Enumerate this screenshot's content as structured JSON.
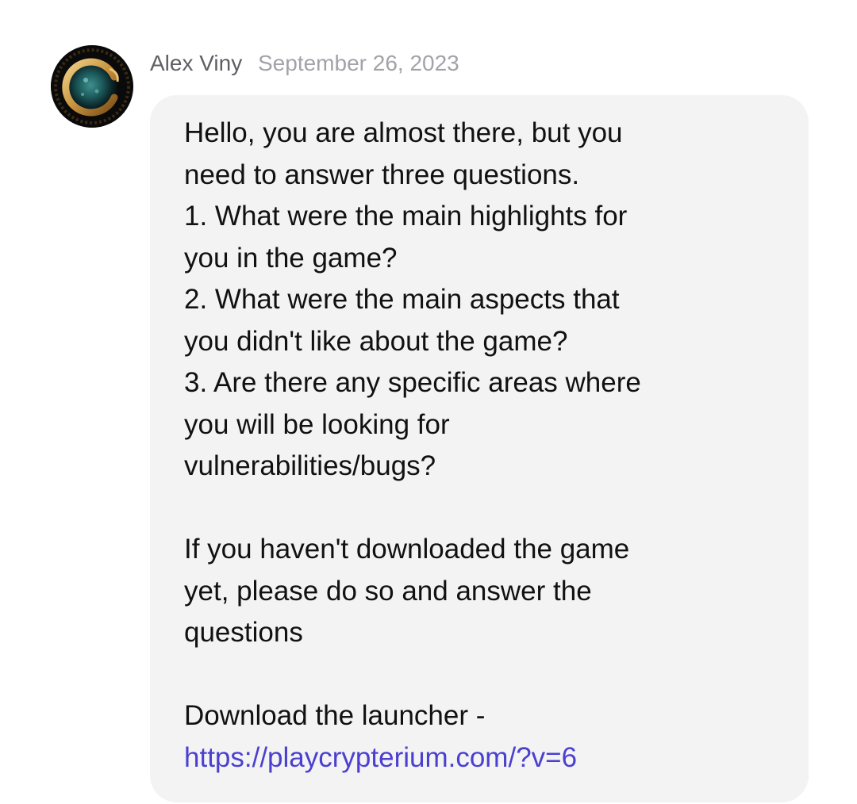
{
  "message": {
    "author": "Alex Viny",
    "date": "September 26, 2023",
    "avatar_icon": "crypterium-logo-icon",
    "lines": [
      "Hello, you are almost there, but you",
      "need to answer three questions.",
      "1. What were the main highlights for",
      "you in the game?",
      "2. What were the main aspects that",
      "you didn't like about the game?",
      "3. Are there any specific areas where",
      "you will be looking for",
      "vulnerabilities/bugs?",
      "",
      "If you haven't downloaded the game",
      "yet, please do so and answer the",
      "questions",
      "",
      "Download the launcher -"
    ],
    "link": "https://playcrypterium.com/?v=6"
  },
  "colors": {
    "bubble_bg": "#f3f3f3",
    "author": "#5f5f64",
    "date": "#a2a2a8",
    "text": "#111111",
    "link": "#4a3fd0"
  }
}
